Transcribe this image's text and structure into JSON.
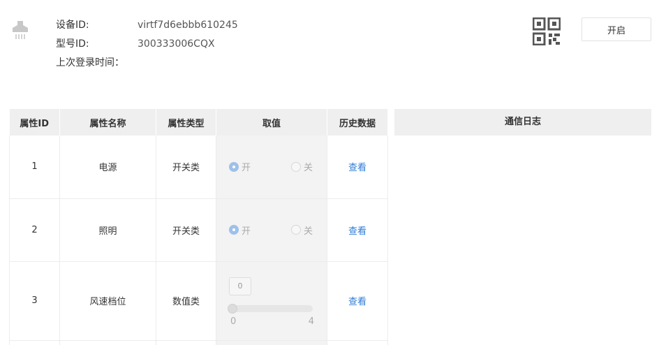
{
  "device": {
    "id_label": "设备ID:",
    "id_value": "virtf7d6ebbb610245",
    "model_label": "型号ID:",
    "model_value": "300333006CQX",
    "last_login_label": "上次登录时间：",
    "last_login_value": ""
  },
  "actions": {
    "open_button": "开启"
  },
  "table": {
    "headers": [
      "属性ID",
      "属性名称",
      "属性类型",
      "取值",
      "历史数据"
    ],
    "rows": [
      {
        "id": "1",
        "name": "电源",
        "type": "开关类",
        "on_label": "开",
        "off_label": "关",
        "value": "开",
        "link": "查看"
      },
      {
        "id": "2",
        "name": "照明",
        "type": "开关类",
        "on_label": "开",
        "off_label": "关",
        "value": "开",
        "link": "查看"
      },
      {
        "id": "3",
        "name": "风速档位",
        "type": "数值类",
        "slider_value": "0",
        "slider_min": "0",
        "slider_max": "4",
        "link": "查看"
      }
    ]
  },
  "log": {
    "title": "通信日志"
  },
  "colors": {
    "link": "#2d7bd6",
    "radio_on": "#9ec0ea",
    "header_bg": "#efefef"
  }
}
